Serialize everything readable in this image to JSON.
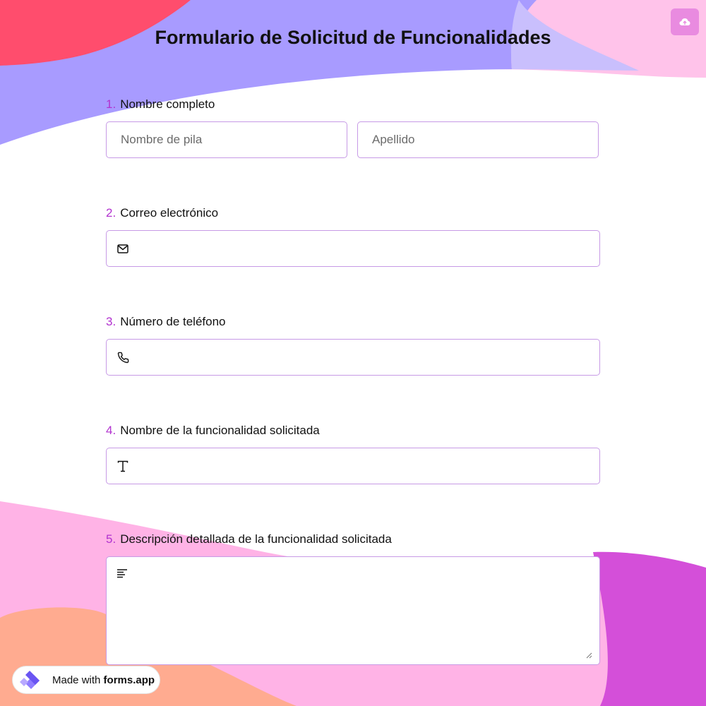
{
  "form": {
    "title": "Formulario de Solicitud de Funcionalidades",
    "questions": [
      {
        "number": "1.",
        "label": "Nombre completo",
        "first_name_placeholder": "Nombre de pila",
        "last_name_placeholder": "Apellido"
      },
      {
        "number": "2.",
        "label": "Correo electrónico",
        "icon": "mail-icon"
      },
      {
        "number": "3.",
        "label": "Número de teléfono",
        "icon": "phone-icon"
      },
      {
        "number": "4.",
        "label": "Nombre de la funcionalidad solicitada",
        "icon": "text-icon"
      },
      {
        "number": "5.",
        "label": "Descripción detallada de la funcionalidad solicitada",
        "icon": "paragraph-icon"
      }
    ]
  },
  "badge": {
    "prefix": "Made with",
    "brand": "forms.app"
  },
  "colors": {
    "accent": "#b232cf",
    "field_border": "#c79ae6",
    "blob_red": "#ff4d6d",
    "blob_lavender": "#a89bff",
    "blob_pink": "#ffb3e6",
    "blob_magenta": "#d44fd9",
    "blob_peach": "#ffab90",
    "save_button": "#e98be0"
  }
}
